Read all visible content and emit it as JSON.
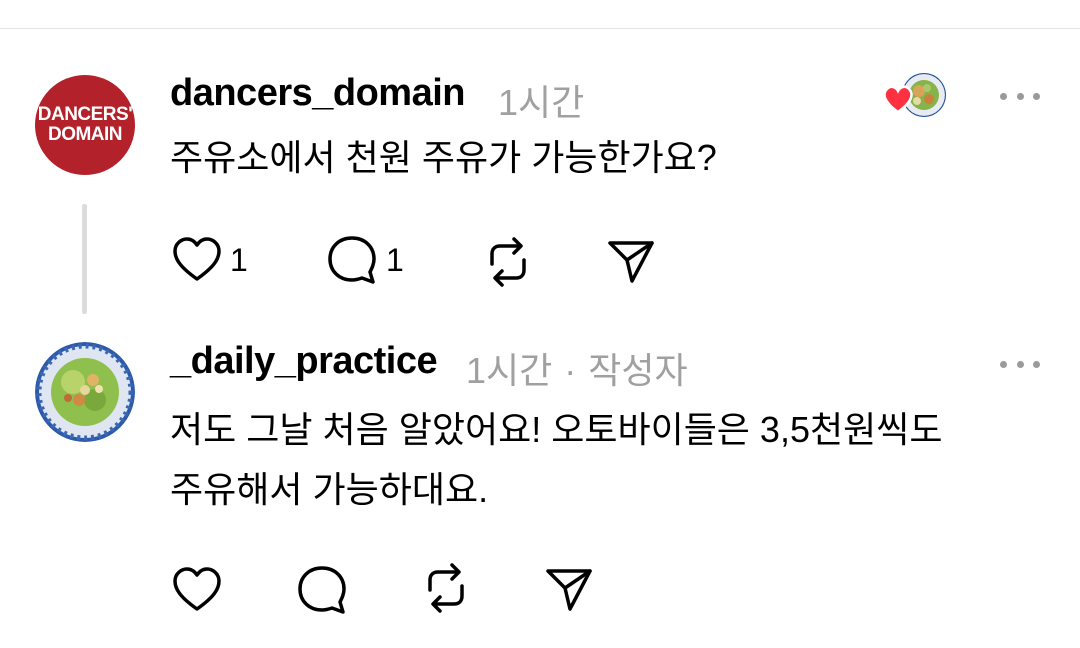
{
  "colors": {
    "brand_red": "#b3222b",
    "meta_gray": "#a0a0a0",
    "heart_red": "#ff3040"
  },
  "post": {
    "avatar_text_line1": "DANCERS'",
    "avatar_text_line2": "DOMAIN",
    "username": "dancers_domain",
    "time": "1시간",
    "text": "주유소에서 천원 주유가 가능한가요?",
    "like_count": "1",
    "reply_count": "1",
    "liked_by_icon": "heart-with-avatar"
  },
  "reply": {
    "username": "_daily_practice",
    "time": "1시간",
    "separator": "·",
    "author_label": "작성자",
    "text_line1": "저도 그날 처음 알았어요! 오토바이들은 3,5천원씩도",
    "text_line2": "주유해서 가능하대요."
  },
  "icons": [
    "heart-icon",
    "comment-icon",
    "repost-icon",
    "send-icon",
    "more-icon"
  ]
}
